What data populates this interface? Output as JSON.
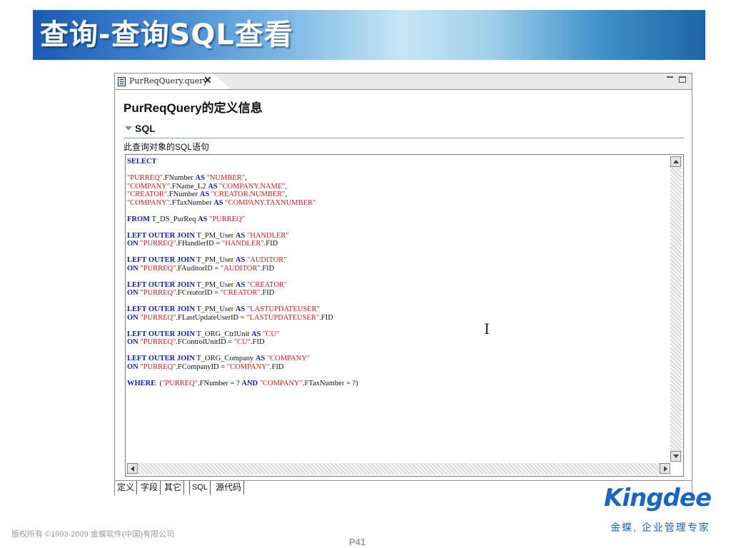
{
  "slide": {
    "title": "查询-查询SQL查看",
    "copyright": "版权所有 ©1993-2009 金蝶软件(中国)有限公司",
    "page": "P41",
    "brand": {
      "logo": "Kingdee",
      "slogan": "金蝶, 企业管理专家",
      "color": "#1a66c2"
    }
  },
  "editor": {
    "tab_label": "PurReqQuery.query",
    "title": "PurReqQuery的定义信息",
    "section": {
      "title": "SQL",
      "description": "此查询对象的SQL语句"
    },
    "sql_lines": [
      [
        {
          "t": "SELECT",
          "c": "kw"
        }
      ],
      [],
      [
        {
          "t": "\"PURREQ\"",
          "c": "str"
        },
        {
          "t": ".FNumber "
        },
        {
          "t": "AS",
          "c": "kw"
        },
        {
          "t": " "
        },
        {
          "t": "\"NUMBER\"",
          "c": "str"
        },
        {
          "t": ","
        }
      ],
      [
        {
          "t": "\"COMPANY\"",
          "c": "str"
        },
        {
          "t": ".FName_L2 "
        },
        {
          "t": "AS",
          "c": "kw"
        },
        {
          "t": " "
        },
        {
          "t": "\"COMPANY.NAME\"",
          "c": "str"
        },
        {
          "t": ","
        }
      ],
      [
        {
          "t": "\"CREATOR\"",
          "c": "str"
        },
        {
          "t": ".FNumber "
        },
        {
          "t": "AS",
          "c": "kw"
        },
        {
          "t": " "
        },
        {
          "t": "\"CREATOR.NUMBER\"",
          "c": "str"
        },
        {
          "t": ","
        }
      ],
      [
        {
          "t": "\"COMPANY\"",
          "c": "str"
        },
        {
          "t": ".FTaxNumber "
        },
        {
          "t": "AS",
          "c": "kw"
        },
        {
          "t": " "
        },
        {
          "t": "\"COMPANY.TAXNUMBER\"",
          "c": "str"
        }
      ],
      [],
      [
        {
          "t": "FROM",
          "c": "kw"
        },
        {
          "t": " T_DS_PurReq "
        },
        {
          "t": "AS",
          "c": "kw"
        },
        {
          "t": " "
        },
        {
          "t": "\"PURREQ\"",
          "c": "str"
        }
      ],
      [],
      [
        {
          "t": "LEFT OUTER JOIN",
          "c": "kw"
        },
        {
          "t": " T_PM_User "
        },
        {
          "t": "AS",
          "c": "kw"
        },
        {
          "t": " "
        },
        {
          "t": "\"HANDLER\"",
          "c": "str"
        }
      ],
      [
        {
          "t": "ON",
          "c": "kw"
        },
        {
          "t": " "
        },
        {
          "t": "\"PURREQ\"",
          "c": "str"
        },
        {
          "t": ".FHandlerID = "
        },
        {
          "t": "\"HANDLER\"",
          "c": "str"
        },
        {
          "t": ".FID"
        }
      ],
      [],
      [
        {
          "t": "LEFT OUTER JOIN",
          "c": "kw"
        },
        {
          "t": " T_PM_User "
        },
        {
          "t": "AS",
          "c": "kw"
        },
        {
          "t": " "
        },
        {
          "t": "\"AUDITOR\"",
          "c": "str"
        }
      ],
      [
        {
          "t": "ON",
          "c": "kw"
        },
        {
          "t": " "
        },
        {
          "t": "\"PURREQ\"",
          "c": "str"
        },
        {
          "t": ".FAuditorID = "
        },
        {
          "t": "\"AUDITOR\"",
          "c": "str"
        },
        {
          "t": ".FID"
        }
      ],
      [],
      [
        {
          "t": "LEFT OUTER JOIN",
          "c": "kw"
        },
        {
          "t": " T_PM_User "
        },
        {
          "t": "AS",
          "c": "kw"
        },
        {
          "t": " "
        },
        {
          "t": "\"CREATOR\"",
          "c": "str"
        }
      ],
      [
        {
          "t": "ON",
          "c": "kw"
        },
        {
          "t": " "
        },
        {
          "t": "\"PURREQ\"",
          "c": "str"
        },
        {
          "t": ".FCreatorID = "
        },
        {
          "t": "\"CREATOR\"",
          "c": "str"
        },
        {
          "t": ".FID"
        }
      ],
      [],
      [
        {
          "t": "LEFT OUTER JOIN",
          "c": "kw"
        },
        {
          "t": " T_PM_User "
        },
        {
          "t": "AS",
          "c": "kw"
        },
        {
          "t": " "
        },
        {
          "t": "\"LASTUPDATEUSER\"",
          "c": "str"
        }
      ],
      [
        {
          "t": "ON",
          "c": "kw"
        },
        {
          "t": " "
        },
        {
          "t": "\"PURREQ\"",
          "c": "str"
        },
        {
          "t": ".FLastUpdateUserID = "
        },
        {
          "t": "\"LASTUPDATEUSER\"",
          "c": "str"
        },
        {
          "t": ".FID"
        }
      ],
      [],
      [
        {
          "t": "LEFT OUTER JOIN",
          "c": "kw"
        },
        {
          "t": " T_ORG_CtrlUnit "
        },
        {
          "t": "AS",
          "c": "kw"
        },
        {
          "t": " "
        },
        {
          "t": "\"CU\"",
          "c": "str"
        }
      ],
      [
        {
          "t": "ON",
          "c": "kw"
        },
        {
          "t": " "
        },
        {
          "t": "\"PURREQ\"",
          "c": "str"
        },
        {
          "t": ".FControlUnitID = "
        },
        {
          "t": "\"CU\"",
          "c": "str"
        },
        {
          "t": ".FID"
        }
      ],
      [],
      [
        {
          "t": "LEFT OUTER JOIN",
          "c": "kw"
        },
        {
          "t": " T_ORG_Company "
        },
        {
          "t": "AS",
          "c": "kw"
        },
        {
          "t": " "
        },
        {
          "t": "\"COMPANY\"",
          "c": "str"
        }
      ],
      [
        {
          "t": "ON",
          "c": "kw"
        },
        {
          "t": " "
        },
        {
          "t": "\"PURREQ\"",
          "c": "str"
        },
        {
          "t": ".FCompanyID = "
        },
        {
          "t": "\"COMPANY\"",
          "c": "str"
        },
        {
          "t": ".FID"
        }
      ],
      [],
      [
        {
          "t": "WHERE",
          "c": "kw"
        },
        {
          "t": "  ("
        },
        {
          "t": "\"PURREQ\"",
          "c": "str"
        },
        {
          "t": ".FNumber = ? "
        },
        {
          "t": "AND",
          "c": "kw"
        },
        {
          "t": " "
        },
        {
          "t": "\"COMPANY\"",
          "c": "str"
        },
        {
          "t": ".FTaxNumber = ?)"
        }
      ]
    ],
    "bottom_tabs": [
      {
        "label": "定义",
        "active": false
      },
      {
        "label": "字段",
        "active": false
      },
      {
        "label": "其它",
        "active": false
      },
      {
        "label": "SQL",
        "active": true
      },
      {
        "label": "源代码",
        "active": false
      }
    ]
  },
  "colors": {
    "keyword": "#0a1fb5",
    "string": "#d21a1a"
  },
  "icons": [
    "query-file-icon",
    "close-icon",
    "minimize-icon",
    "maximize-icon",
    "collapse-twisty-icon",
    "scroll-up-icon",
    "scroll-down-icon",
    "scroll-left-icon",
    "scroll-right-icon",
    "text-cursor-icon"
  ]
}
